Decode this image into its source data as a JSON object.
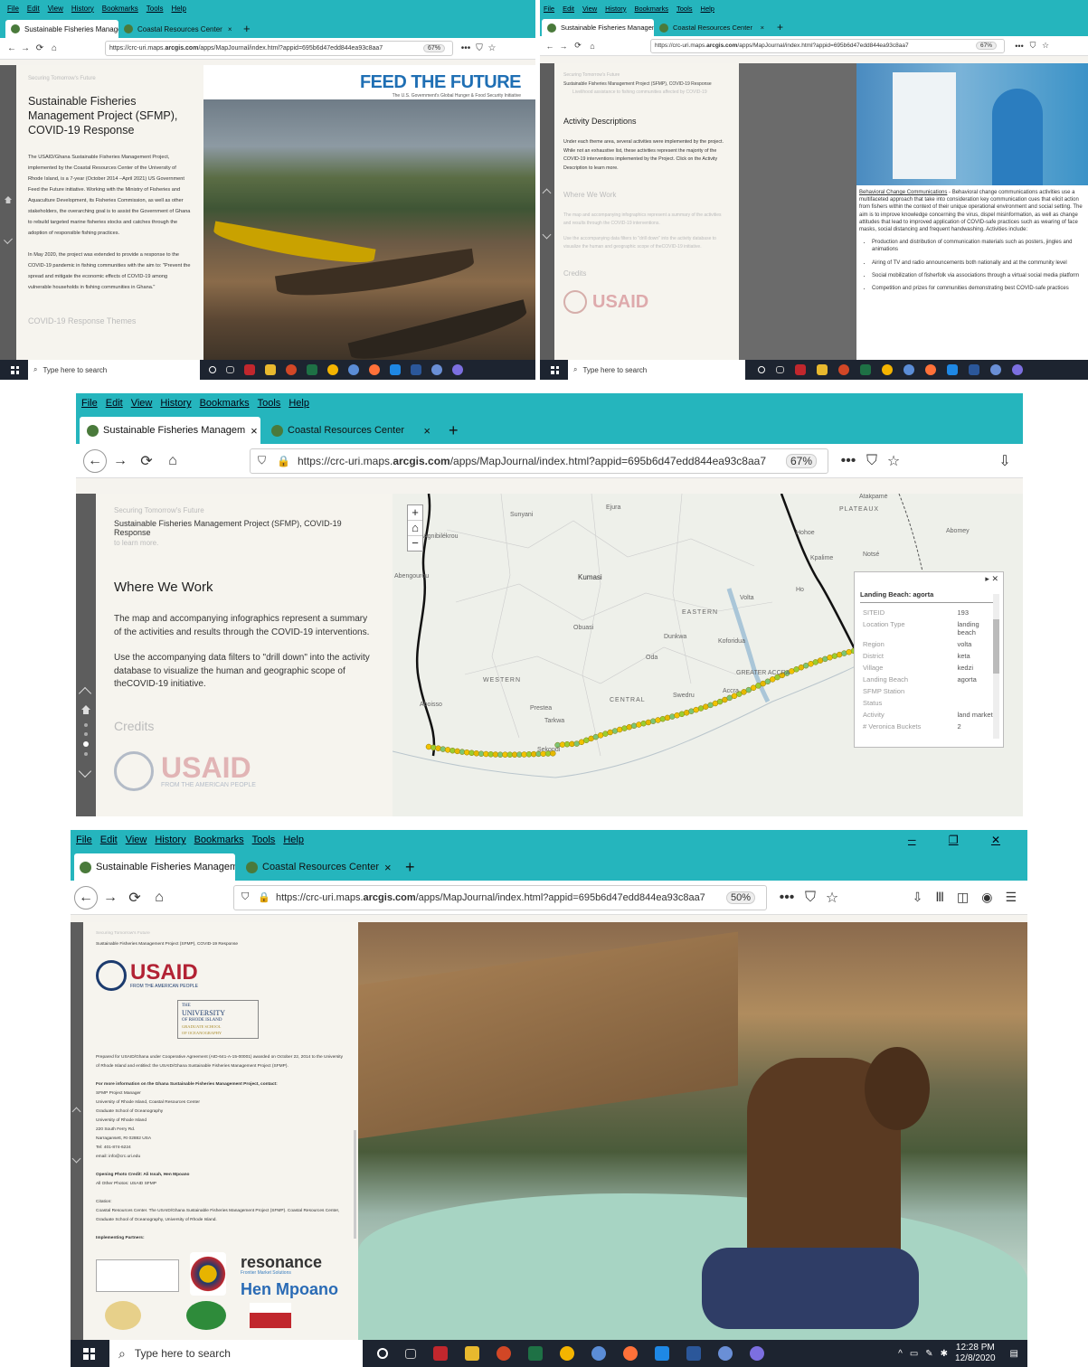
{
  "menu": [
    "File",
    "Edit",
    "View",
    "History",
    "Bookmarks",
    "Tools",
    "Help"
  ],
  "tabs": {
    "active": "Sustainable Fisheries Managem",
    "inactive": "Coastal Resources Center",
    "close": "×",
    "plus": "+"
  },
  "url": {
    "prefix": "https://crc-uri.maps.",
    "domain": "arcgis.com",
    "path": "/apps/MapJournal/index.html?appid=695b6d47edd844ea93c8aa7",
    "zoom67": "67%",
    "zoom50": "50%"
  },
  "nav": {
    "back": "←",
    "fwd": "→",
    "reload": "⟳",
    "home": "⌂",
    "more": "•••",
    "pocket": "⛉",
    "star": "☆"
  },
  "taskbar": {
    "search": "Type here to search",
    "time": "12:28 PM",
    "date": "12/8/2020"
  },
  "s1": {
    "ghost": "Securing Tomorrow's Future",
    "title": "Sustainable Fisheries Management Project (SFMP), COVID-19 Response",
    "p1": "The USAID/Ghana Sustainable Fisheries Management Project, implemented by the Coastal Resources Center of the University of Rhode Island, is a 7-year (October 2014 –April 2021) US Government Feed the Future initiative. Working with the Ministry of Fisheries and Aquaculture Development, its Fisheries Commission, as well as other stakeholders, the overarching goal is to assist the Government of Ghana to rebuild targeted marine fisheries stocks and catches through the adoption of responsible fishing practices.",
    "p2": "In May 2020, the project was extended to provide a response to the COVID-19 pandemic in fishing communities with the aim to: \"Prevent the spread and mitigate the economic effects of COVID-19 among vulnerable households in fishing communities in Ghana.\"",
    "next": "COVID-19 Response Themes",
    "logo": "FEED THE FUTURE",
    "logosub": "The U.S. Government's Global Hunger & Food Security Initiative"
  },
  "s2": {
    "ghost": "Securing Tomorrow's Future",
    "crumb": "Sustainable Fisheries Management Project (SFMP), COVID-19 Response",
    "bullet": "Livelihood assistance to fishing communities affected by COVID-19",
    "title": "Activity Descriptions",
    "p1": "Under each theme area, several activities were implemented by the project. While not an exhaustive list, these activities represent the majority of the COVID-19 interventions implemented by the Project. Click on the Activity Description to learn more.",
    "next": "Where We Work",
    "g1": "The map and accompanying infographics represent a summary of the activities and results through the COVID-19 interventions.",
    "g2": "Use the accompanying data filters to \"drill down\" into the activity database to visualize the human and geographic scope of theCOVID-19 initiative.",
    "credits": "Credits",
    "usaid": "USAID",
    "link": "Behavioral Change Communications",
    "desc": " - Behavioral change communications activities use a multifaceted approach that take into consideration key communication cues that elicit action from fishers within the context of their unique operational environment and social setting. The aim is to improve knowledge concerning the virus, dispel misinformation, as well as change attitudes that lead to improved application of COVID-safe practices such as wearing of face masks, social distancing and frequent handwashing. Activities include:",
    "items": [
      "Production and distribution of communication materials such as posters, jingles and animations",
      "Airing of TV and radio announcements both nationally and at the community level",
      "Social mobilization of fisherfolk via associations through a virtual social media platform",
      "Competition and prizes for communities demonstrating best COVID-safe practices"
    ]
  },
  "s3": {
    "ghost": "Securing Tomorrow's Future",
    "crumb": "Sustainable Fisheries Management Project (SFMP), COVID-19 Response",
    "ghost2": "to learn more.",
    "title": "Where We Work",
    "p1": "The map and accompanying infographics represent a summary of the activities and results through the COVID-19 interventions.",
    "p2": "Use the accompanying data filters to \"drill down\" into the activity database to visualize the human and geographic scope of theCOVID-19 initiative.",
    "credits": "Credits",
    "usaid": "USAID",
    "usaidsub": "FROM THE AMERICAN PEOPLE",
    "popup": {
      "title": "Landing Beach: agorta",
      "rows": [
        [
          "SITEID",
          "193"
        ],
        [
          "Location Type",
          "landing beach"
        ],
        [
          "Region",
          "volta"
        ],
        [
          "District",
          "keta"
        ],
        [
          "Village",
          "kedzi"
        ],
        [
          "Landing Beach",
          "agorta"
        ],
        [
          "SFMP Station",
          ""
        ],
        [
          "Status",
          ""
        ],
        [
          "Activity",
          "land market"
        ],
        [
          "# Veronica Buckets",
          "2"
        ]
      ]
    },
    "places": [
      "Sunyani",
      "Ejura",
      "Kumasi",
      "Obuasi",
      "Koforidua",
      "Accra",
      "Sekondi",
      "Tarkwa",
      "Prestea",
      "Aboisso",
      "Volta",
      "Kpalime",
      "Notsé",
      "EASTERN",
      "WESTERN",
      "CENTRAL",
      "GREATER ACCRA",
      "PLATEAUX",
      "Atakpamé",
      "Ho",
      "Hohoe",
      "Agnibilékrou",
      "Abengourou",
      "Oda",
      "Dunkwa",
      "Swedru",
      "Abomey"
    ]
  },
  "s4": {
    "ghost": "Securing Tomorrow's Future",
    "crumb": "Sustainable Fisheries Management Project (SFMP), COVID-19 Response",
    "usaid": "USAID",
    "usaidsub": "FROM THE AMERICAN PEOPLE",
    "uri": [
      "THE",
      "UNIVERSITY",
      "OF RHODE ISLAND",
      "GRADUATE SCHOOL",
      "OF OCEANOGRAPHY"
    ],
    "prepared": "Prepared for USAID/Ghana under Cooperative Agreement (AID-641-A-15-00001) awarded on October 22, 2014 to the University of Rhode Island and entitled: the USAID/Ghana Sustainable Fisheries Management Project (SFMP).",
    "contactHead": "For more information on the Ghana Sustainable Fisheries Management Project, contact:",
    "contact": [
      "SFMP Project Manager",
      "University of Rhode Island, Coastal Resources Center",
      "Graduate School of Oceanography",
      "University of Rhode Island",
      "220 South Ferry Rd.",
      "Narragansett, RI 02882 USA",
      "Tel: 401-874-6224",
      "email: info@crc.uri.edu"
    ],
    "photo": "Opening Photo Credit: Ali Issah, Hen Mpoano",
    "photo2": "All Other Photos: USAID SFMP",
    "citation": "Citation:",
    "citationText": "Coastal Resources Center. The USAID/Ghana Sustainable Fisheries Management Project (SFMP). Coastal Resources Center, Graduate School of Oceanography, University of Rhode Island.",
    "partners": "Implementing Partners:",
    "resonance": "resonance",
    "resSub": "Frontier Market Solutions",
    "hen": "Hen Mpoano"
  }
}
